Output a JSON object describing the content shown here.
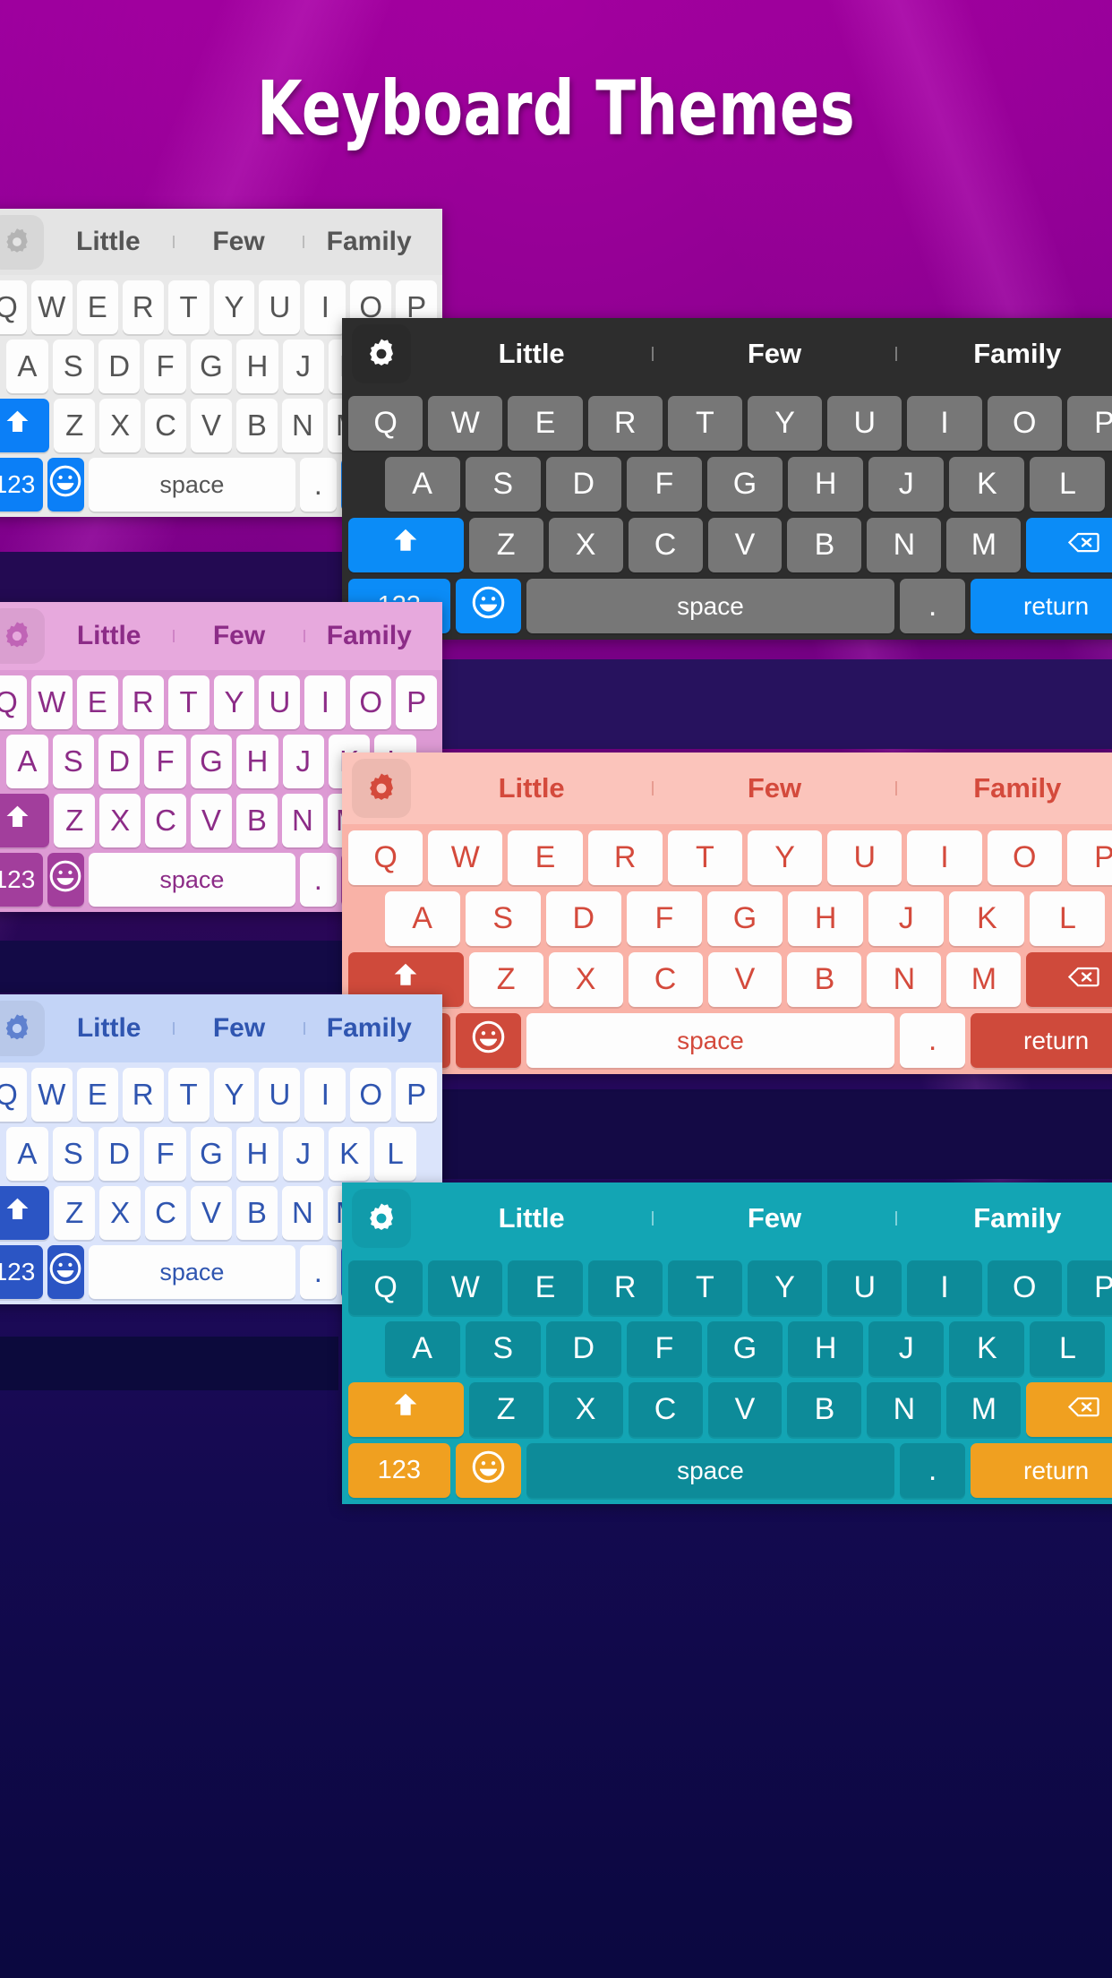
{
  "page": {
    "title": "Keyboard Themes",
    "background_colors": [
      "#8e0091",
      "#6d0080",
      "#230a5e",
      "#0a0840"
    ]
  },
  "suggestions": {
    "word1": "Little",
    "word2": "Few",
    "word3": "Family",
    "gear_icon": "gear-icon"
  },
  "keyboard_rows": {
    "row1": [
      "Q",
      "W",
      "E",
      "R",
      "T",
      "Y",
      "U",
      "I",
      "O",
      "P"
    ],
    "row2": [
      "A",
      "S",
      "D",
      "F",
      "G",
      "H",
      "J",
      "K",
      "L"
    ],
    "row3": [
      "Z",
      "X",
      "C",
      "V",
      "B",
      "N",
      "M"
    ],
    "shift_label": "shift-arrow-icon",
    "backspace_label": "backspace-icon",
    "num_label": "123",
    "emoji_label": "emoji-smiley-icon",
    "space_label": "space",
    "period_label": ".",
    "return_label": "return"
  },
  "themes": [
    {
      "name": "light",
      "bar_bg": "#e4e4e4",
      "bar_text": "#555555",
      "divider": "#bcbcbc",
      "gear": "#b4b4b4",
      "kb_bg": "#e9e9e9",
      "key_bg": "#fdfdfd",
      "key_text": "#555555",
      "accent_bg": "#0b7ff7",
      "accent_text": "#ffffff"
    },
    {
      "name": "dark",
      "bar_bg": "#2d2d2d",
      "bar_text": "#ffffff",
      "divider": "#7a7a7a",
      "gear": "#ffffff",
      "kb_bg": "#2d2d2d",
      "key_bg": "#777777",
      "key_text": "#ffffff",
      "accent_bg": "#0b8cf7",
      "accent_text": "#ffffff"
    },
    {
      "name": "pink",
      "bar_bg": "#e7a9dd",
      "bar_text": "#8c2c87",
      "divider": "#cf84c6",
      "gear": "#c064b6",
      "kb_bg": "#dd9ad4",
      "key_bg": "#fdfdfd",
      "key_text": "#8c2c87",
      "accent_bg": "#a23e9c",
      "accent_text": "#ffffff"
    },
    {
      "name": "coral",
      "bar_bg": "#fbc4bb",
      "bar_text": "#d44a3c",
      "divider": "#e79c91",
      "gear": "#d44a3c",
      "kb_bg": "#f9b2a7",
      "key_bg": "#fdfdfd",
      "key_text": "#d44a3c",
      "accent_bg": "#cf4a3b",
      "accent_text": "#ffffff"
    },
    {
      "name": "lightblue",
      "bar_bg": "#c3d4f7",
      "bar_text": "#2f55b0",
      "divider": "#9bb2e2",
      "gear": "#5f81cf",
      "kb_bg": "#dbe4fb",
      "key_bg": "#fdfdfd",
      "key_text": "#2f55b0",
      "accent_bg": "#2b55c4",
      "accent_text": "#ffffff"
    },
    {
      "name": "teal",
      "bar_bg": "#13a5b4",
      "bar_text": "#ffffff",
      "divider": "#7fd2da",
      "gear": "#ffffff",
      "kb_bg": "#13a5b4",
      "key_bg": "#0d8b99",
      "key_text": "#ffffff",
      "accent_bg": "#f0a020",
      "accent_text": "#ffffff"
    }
  ]
}
